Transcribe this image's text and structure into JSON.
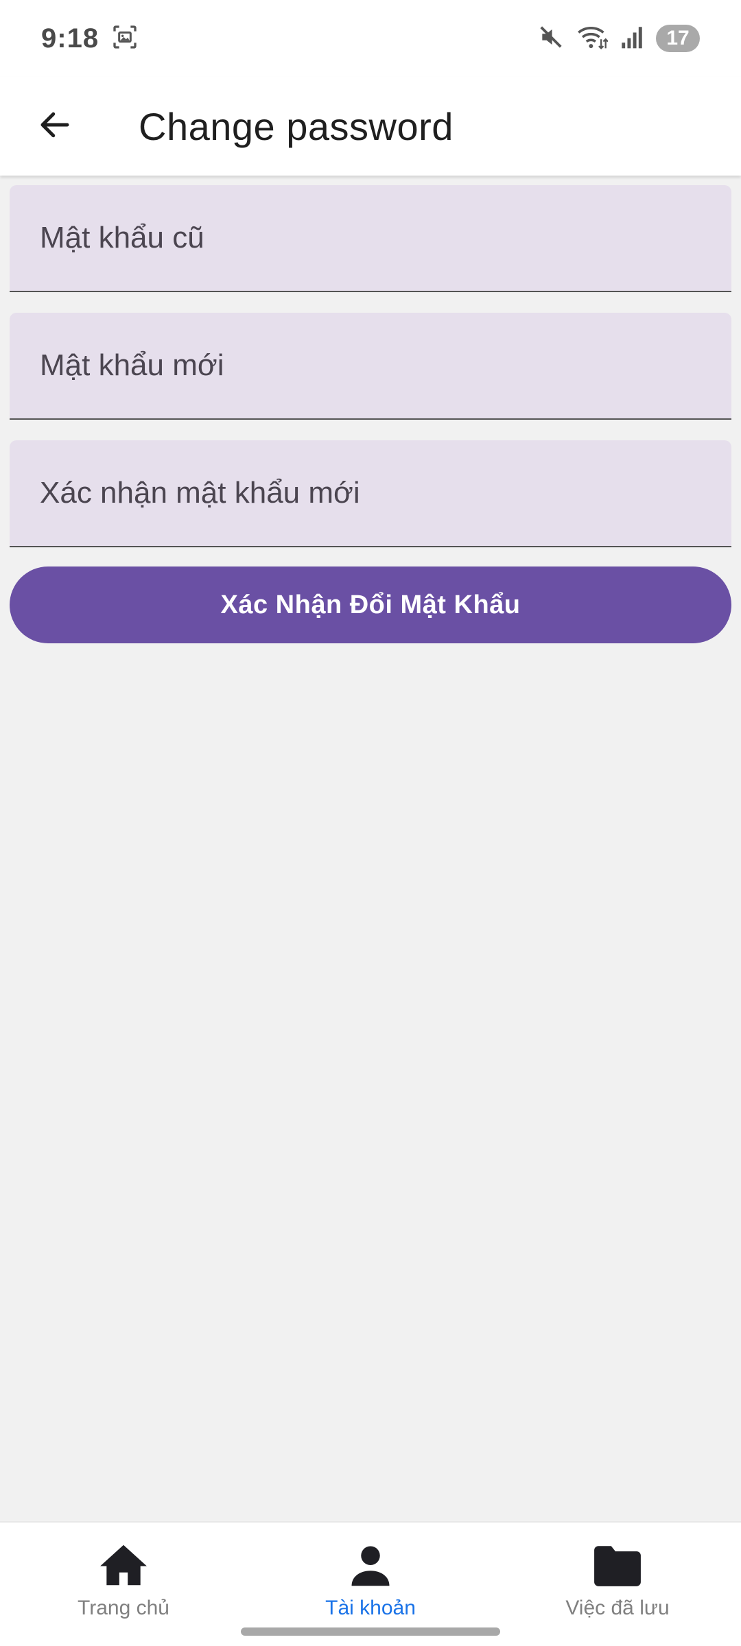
{
  "status_bar": {
    "time": "9:18",
    "battery": "17",
    "icons": [
      "screenshot-icon",
      "mute-icon",
      "wifi-icon",
      "signal-icon"
    ]
  },
  "app_bar": {
    "back_icon": "arrow-left-icon",
    "title": "Change password"
  },
  "form": {
    "old_password": {
      "placeholder": "Mật khẩu cũ",
      "value": ""
    },
    "new_password": {
      "placeholder": "Mật khẩu mới",
      "value": ""
    },
    "confirm_password": {
      "placeholder": "Xác nhận mật khẩu mới",
      "value": ""
    },
    "submit_label": "Xác Nhận Đổi Mật Khẩu"
  },
  "bottom_nav": {
    "items": [
      {
        "label": "Trang chủ",
        "icon": "home-icon",
        "active": false
      },
      {
        "label": "Tài khoản",
        "icon": "person-icon",
        "active": true
      },
      {
        "label": "Việc đã lưu",
        "icon": "folder-icon",
        "active": false
      }
    ]
  },
  "colors": {
    "accent": "#6a50a4",
    "field_background": "#e6dfec",
    "active_nav": "#1a73e8",
    "page_background": "#f1f1f1"
  }
}
